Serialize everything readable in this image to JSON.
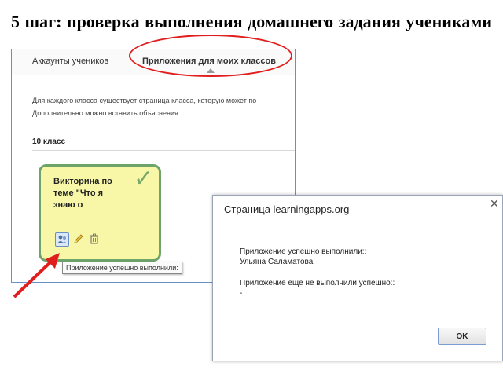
{
  "slide": {
    "title": "5 шаг: проверка выполнения домашнего задания учениками"
  },
  "tabs": [
    {
      "label": "Аккаунты учеников"
    },
    {
      "label": "Приложения для моих классов"
    }
  ],
  "page": {
    "description_line1": "Для каждого класса существует страница класса, которую может по",
    "description_line2": "Дополнительно можно вставить объяснения.",
    "class_title": "10 класс"
  },
  "card": {
    "title": "Викторина по теме \"Что я знаю о",
    "border_color": "#6ea36a",
    "background": "#f7f7a7",
    "icons": [
      "users-icon",
      "pencil-icon",
      "trash-icon"
    ],
    "tooltip": "Приложение успешно выполнили:"
  },
  "dialog": {
    "title": "Страница learningapps.org",
    "line1": "Приложение успешно выполнили::",
    "line2": "Ульяна Саламатова",
    "line3": "Приложение еще не выполнили успешно::",
    "line4": "-",
    "ok_label": "OK"
  },
  "colors": {
    "highlight": "#e01e1e",
    "frame": "#6a8fc7"
  }
}
